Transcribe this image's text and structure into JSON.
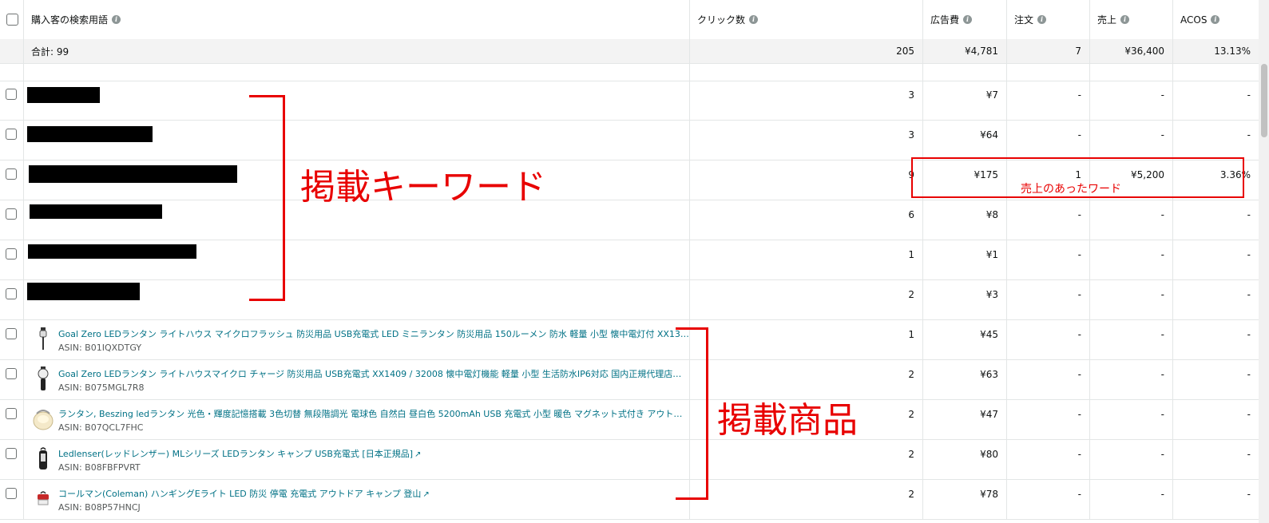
{
  "header": {
    "search_term": "購入客の検索用語",
    "clicks": "クリック数",
    "spend": "広告費",
    "orders": "注文",
    "sales": "売上",
    "acos": "ACOS"
  },
  "total": {
    "label": "合計: 99",
    "clicks": "205",
    "spend": "¥4,781",
    "orders": "7",
    "sales": "¥36,400",
    "acos": "13.13%"
  },
  "keyword_rows": [
    {
      "clicks": "3",
      "spend": "¥7",
      "orders": "-",
      "sales": "-",
      "acos": "-"
    },
    {
      "clicks": "3",
      "spend": "¥64",
      "orders": "-",
      "sales": "-",
      "acos": "-"
    },
    {
      "clicks": "9",
      "spend": "¥175",
      "orders": "1",
      "sales": "¥5,200",
      "acos": "3.36%"
    },
    {
      "clicks": "6",
      "spend": "¥8",
      "orders": "-",
      "sales": "-",
      "acos": "-"
    },
    {
      "clicks": "1",
      "spend": "¥1",
      "orders": "-",
      "sales": "-",
      "acos": "-"
    },
    {
      "clicks": "2",
      "spend": "¥3",
      "orders": "-",
      "sales": "-",
      "acos": "-"
    }
  ],
  "product_rows": [
    {
      "title": "Goal Zero LEDランタン ライトハウス マイクロフラッシュ 防災用品 USB充電式 LED ミニランタン 防災用品 150ルーメン 防水 軽量 小型 懐中電灯付 XX1366...",
      "asin": "ASIN: B01IQXDTGY",
      "icon": "lantern-icon",
      "clicks": "1",
      "spend": "¥45",
      "orders": "-",
      "sales": "-",
      "acos": "-"
    },
    {
      "title": "Goal Zero LEDランタン ライトハウスマイクロ チャージ 防災用品 USB充電式 XX1409 / 32008 懐中電灯機能 軽量 小型 生活防水IP6対応 国内正規代理店販売...",
      "asin": "ASIN: B075MGL7R8",
      "icon": "lantern-icon",
      "clicks": "2",
      "spend": "¥63",
      "orders": "-",
      "sales": "-",
      "acos": "-"
    },
    {
      "title": "ランタン, Beszing ledランタン 光色・輝度記憶搭載 3色切替 無段階調光 電球色 自然白 昼白色 5200mAh USB 充電式 小型 暖色 マグネット式付き アウトド...",
      "asin": "ASIN: B07QCL7FHC",
      "icon": "lantern-icon",
      "clicks": "2",
      "spend": "¥47",
      "orders": "-",
      "sales": "-",
      "acos": "-"
    },
    {
      "title": "Ledlenser(レッドレンザー) MLシリーズ LEDランタン キャンプ USB充電式 [日本正規品]",
      "asin": "ASIN: B08FBFPVRT",
      "icon": "lantern-icon",
      "clicks": "2",
      "spend": "¥80",
      "orders": "-",
      "sales": "-",
      "acos": "-"
    },
    {
      "title": "コールマン(Coleman) ハンギングEライト LED 防災 停電 充電式 アウトドア キャンプ 登山",
      "asin": "ASIN: B08P57HNCJ",
      "icon": "lantern-icon",
      "clicks": "2",
      "spend": "¥78",
      "orders": "-",
      "sales": "-",
      "acos": "-"
    }
  ],
  "annotations": {
    "keywords_label": "掲載キーワード",
    "sales_word_label": "売上のあったワード",
    "products_label": "掲載商品",
    "color": "#e80000"
  },
  "colors": {
    "link": "#007185",
    "total_bg": "#f3f3f3"
  }
}
